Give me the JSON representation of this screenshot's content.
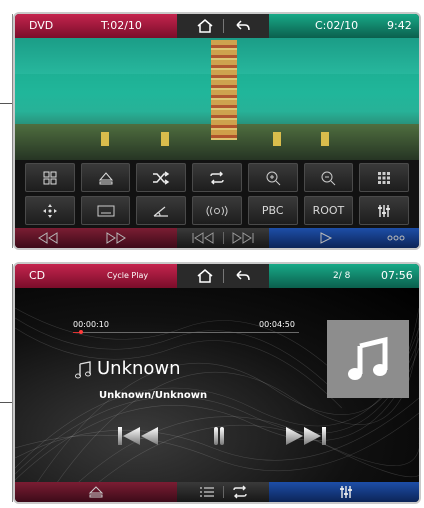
{
  "dvd_screen": {
    "source_label": "DVD",
    "title_info": "T:02/10",
    "chapter_info": "C:02/10",
    "clock": "9:42",
    "home_icon": "home-icon",
    "back_icon": "back-arrow-icon",
    "controls_row1": [
      {
        "icon": "grid-menu-icon"
      },
      {
        "icon": "eject-icon"
      },
      {
        "icon": "shuffle-icon"
      },
      {
        "icon": "repeat-icon"
      },
      {
        "icon": "zoom-in-icon"
      },
      {
        "icon": "zoom-out-icon"
      },
      {
        "icon": "keypad-icon"
      }
    ],
    "controls_row2": [
      {
        "icon": "move-arrows-icon"
      },
      {
        "icon": "subtitle-icon"
      },
      {
        "icon": "angle-icon"
      },
      {
        "icon": "audio-icon"
      },
      {
        "label": "PBC"
      },
      {
        "label": "ROOT"
      },
      {
        "icon": "equalizer-icon"
      }
    ],
    "bottom_bar": [
      "rewind-icon",
      "fast-forward-icon",
      "previous-chapter-icon",
      "next-chapter-icon",
      "play-icon",
      "more-icon"
    ]
  },
  "cd_screen": {
    "source_label": "CD",
    "mode_label": "Cycle Play",
    "track_counter": "2/ 8",
    "clock": "07:56",
    "elapsed_time": "00:00:10",
    "total_time": "00:04:50",
    "progress": 0.034,
    "track_title": "Unknown",
    "artist_album": "Unknown/Unknown",
    "controls": [
      "previous-track-icon",
      "pause-icon",
      "next-track-icon"
    ],
    "bottom_bar": [
      "eject-icon",
      "list-icon",
      "repeat-icon",
      "equalizer-icon"
    ],
    "colors": {
      "accent_red": "#c4254e",
      "accent_green": "#18a987",
      "accent_blue": "#1d4ea8"
    }
  }
}
